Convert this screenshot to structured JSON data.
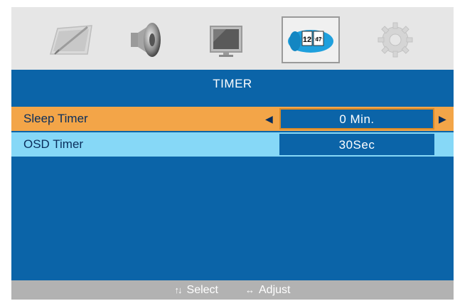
{
  "icons": [
    {
      "name": "picture-icon",
      "active": false
    },
    {
      "name": "sound-icon",
      "active": false
    },
    {
      "name": "tv-screen-icon",
      "active": false
    },
    {
      "name": "timer-icon",
      "active": true,
      "digits": [
        "12",
        "47"
      ]
    },
    {
      "name": "settings-gear-icon",
      "active": false
    }
  ],
  "header": {
    "title": "TIMER"
  },
  "menu": {
    "rows": [
      {
        "label": "Sleep Timer",
        "value": "0 Min.",
        "selected": true
      },
      {
        "label": "OSD Timer",
        "value": "30Sec",
        "selected": false
      }
    ]
  },
  "footer": {
    "select_icon": "↑↓",
    "select_label": "Select",
    "adjust_icon": "↔",
    "adjust_label": "Adjust"
  },
  "colors": {
    "background": "#0b64a8",
    "highlight_row": "#f3a548",
    "secondary_row": "#86d8f7",
    "icon_bar": "#e6e6e6",
    "footer": "#b2b2b2"
  }
}
